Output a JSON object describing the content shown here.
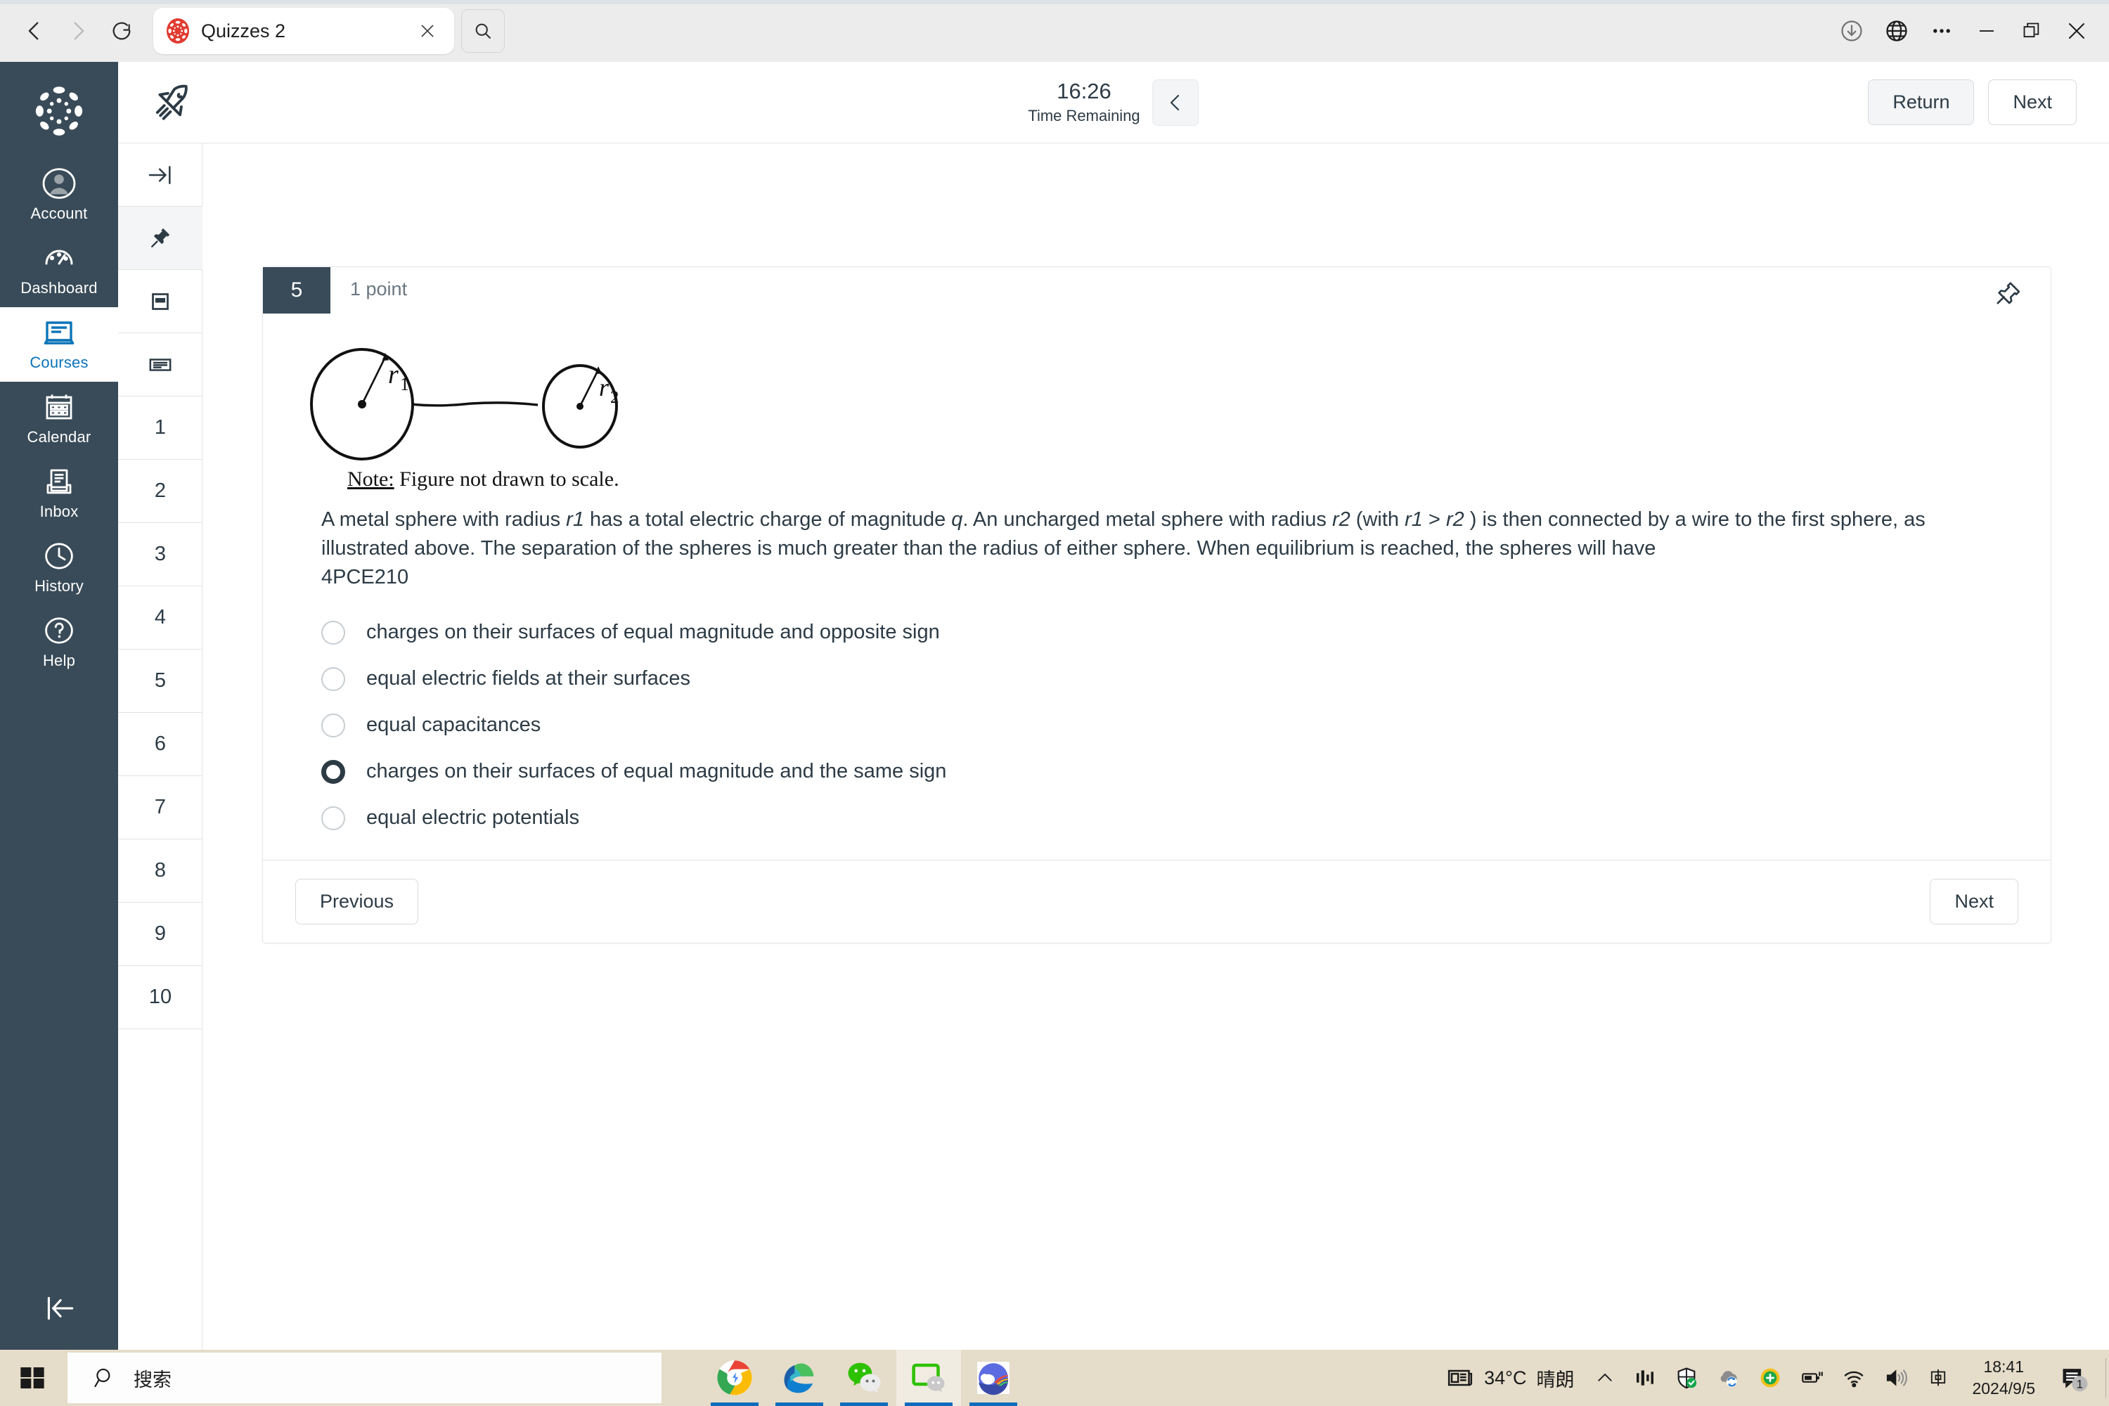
{
  "browser": {
    "back_icon": "back-arrow-icon",
    "forward_icon": "forward-arrow-icon",
    "reload_icon": "reload-icon",
    "tab": {
      "title": "Quizzes 2",
      "favicon": "canvas-logo-icon",
      "close_icon": "close-icon"
    },
    "tab_search_icon": "search-icon",
    "right_icons": [
      {
        "name": "downloads-icon"
      },
      {
        "name": "globe-icon"
      },
      {
        "name": "more-options-icon"
      },
      {
        "name": "minimize-icon"
      },
      {
        "name": "restore-icon"
      },
      {
        "name": "close-window-icon"
      }
    ]
  },
  "canvas_rail": {
    "logo": "canvas-logo-icon",
    "items": [
      {
        "label": "Account",
        "icon": "user-avatar-icon",
        "active": false
      },
      {
        "label": "Dashboard",
        "icon": "dashboard-gauge-icon",
        "active": false
      },
      {
        "label": "Courses",
        "icon": "courses-book-icon",
        "active": true
      },
      {
        "label": "Calendar",
        "icon": "calendar-icon",
        "active": false
      },
      {
        "label": "Inbox",
        "icon": "inbox-tray-icon",
        "active": false
      },
      {
        "label": "History",
        "icon": "clock-icon",
        "active": false
      },
      {
        "label": "Help",
        "icon": "question-mark-icon",
        "active": false
      }
    ],
    "collapse_icon": "collapse-left-icon"
  },
  "quiz_header": {
    "rocket_icon": "rocket-icon",
    "timer_value": "16:26",
    "timer_label": "Time Remaining",
    "timer_toggle_icon": "chevron-left-icon",
    "return_label": "Return",
    "next_label": "Next"
  },
  "question_nav": {
    "top_icons": [
      {
        "name": "collapse-panel-icon",
        "shaded": false
      },
      {
        "name": "pin-icon",
        "shaded": true
      },
      {
        "name": "question-block-icon",
        "shaded": false
      },
      {
        "name": "text-block-icon",
        "shaded": false
      }
    ],
    "numbers": [
      "1",
      "2",
      "3",
      "4",
      "5",
      "6",
      "7",
      "8",
      "9",
      "10"
    ]
  },
  "question": {
    "number": "5",
    "points": "1 point",
    "pin_icon": "pin-icon",
    "figure": {
      "label_left": "r",
      "label_left_sub": "1",
      "label_right": "r",
      "label_right_sub": "2",
      "note_bold": "Note:",
      "note_text": " Figure not drawn to scale."
    },
    "text_line1_a": "A metal sphere with radius ",
    "text_r1": "r1",
    "text_line1_b": " has a total electric charge of magnitude ",
    "text_q": "q",
    "text_line1_c": ". An uncharged metal sphere with radius ",
    "text_r2": "r2",
    "text_line1_d": " (with ",
    "text_r1b": "r1",
    "text_gt": " > ",
    "text_r2b": "r2",
    "text_line1_e": " ) is then connected by a wire to the first sphere, as illustrated above. The separation of the spheres is much greater than the radius of either sphere. When equilibrium is reached, the spheres will have",
    "text_code": "4PCE210",
    "options": [
      {
        "label": "charges on their surfaces of equal magnitude and opposite sign",
        "selected": false
      },
      {
        "label": "equal electric fields at their surfaces",
        "selected": false
      },
      {
        "label": "equal capacitances",
        "selected": false
      },
      {
        "label": "charges on their surfaces of equal magnitude and the same sign",
        "selected": true
      },
      {
        "label": "equal electric potentials",
        "selected": false
      }
    ],
    "previous_label": "Previous",
    "next_label": "Next"
  },
  "taskbar": {
    "start_icon": "windows-start-icon",
    "search_icon": "search-icon",
    "search_placeholder": "搜索",
    "apps": [
      {
        "name": "chrome-icon",
        "active": false
      },
      {
        "name": "edge-icon",
        "active": false
      },
      {
        "name": "wechat-icon",
        "active": false
      },
      {
        "name": "wechat-devtools-icon",
        "active": true
      },
      {
        "name": "weather-app-icon",
        "active": false
      }
    ],
    "tray": {
      "news_icon": "news-icon",
      "temperature": "34°C",
      "weather_text": "晴朗",
      "chevron_icon": "chevron-up-icon",
      "icons": [
        {
          "name": "monitor-bars-icon"
        },
        {
          "name": "security-shield-icon"
        },
        {
          "name": "onedrive-sync-icon"
        },
        {
          "name": "plus-circle-icon"
        },
        {
          "name": "battery-plug-icon"
        },
        {
          "name": "wifi-icon"
        },
        {
          "name": "volume-icon"
        },
        {
          "name": "ime-chinese-icon"
        }
      ],
      "time": "18:41",
      "date": "2024/9/5",
      "notification_icon": "notification-icon",
      "notification_count": "1"
    }
  },
  "colors": {
    "canvas_dark": "#394B58",
    "canvas_blue": "#0b74b8",
    "text": "#2d3b45",
    "taskbar": "#e5dcc9"
  }
}
